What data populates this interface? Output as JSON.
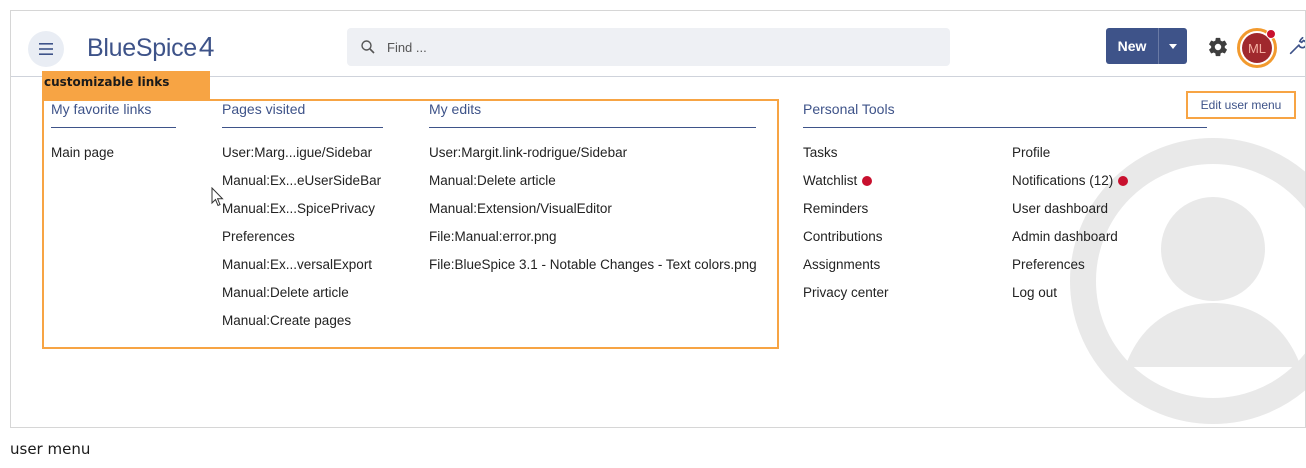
{
  "header": {
    "logo_text": "BlueSpice",
    "logo_num": "4",
    "search_placeholder": "Find ...",
    "new_label": "New",
    "avatar_initials": "ML"
  },
  "annotation": {
    "customizable_label": "customizable links",
    "caption": "user menu"
  },
  "edit_user_menu": "Edit user menu",
  "favorites": {
    "title": "My favorite links",
    "items": [
      "Main page"
    ]
  },
  "pages_visited": {
    "title": "Pages visited",
    "items": [
      "User:Marg...igue/Sidebar",
      "Manual:Ex...eUserSideBar",
      "Manual:Ex...SpicePrivacy",
      "Preferences",
      "Manual:Ex...versalExport",
      "Manual:Delete article",
      "Manual:Create pages"
    ]
  },
  "my_edits": {
    "title": "My edits",
    "items": [
      "User:Margit.link-rodrigue/Sidebar",
      "Manual:Delete article",
      "Manual:Extension/VisualEditor",
      "File:Manual:error.png",
      "File:BlueSpice 3.1 - Notable Changes - Text colors.png"
    ]
  },
  "personal_tools": {
    "title": "Personal Tools",
    "left": [
      "Tasks",
      "Watchlist",
      "Reminders",
      "Contributions",
      "Assignments",
      "Privacy center"
    ],
    "right": [
      "Profile",
      "Notifications (12)",
      "User dashboard",
      "Admin dashboard",
      "Preferences",
      "Log out"
    ]
  },
  "colors": {
    "brand": "#3e5389",
    "highlight": "#f7a444",
    "alert": "#c8102e"
  }
}
